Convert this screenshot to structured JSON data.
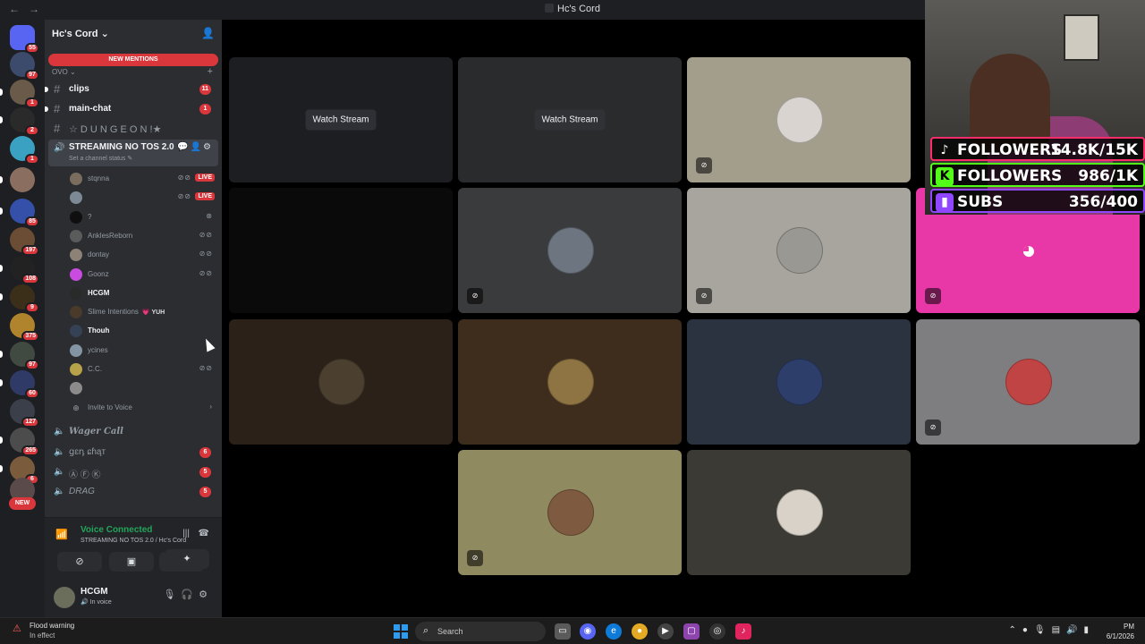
{
  "window": {
    "title": "Hc's Cord"
  },
  "guild": {
    "name": "Hc's Cord",
    "new_mentions": "NEW MENTIONS",
    "category": "OVO",
    "text_channels": [
      {
        "name": "clips",
        "count": "11"
      },
      {
        "name": "main-chat",
        "count": "1"
      },
      {
        "name": "☆ D U N G E O N !★"
      }
    ],
    "active_channel": {
      "name": "STREAMING NO TOS 2.0",
      "status": "Set a channel status"
    },
    "voice_users": [
      {
        "name": "stqnna",
        "live": "LIVE",
        "color": "#7a6d5e"
      },
      {
        "name": "",
        "live": "LIVE",
        "color": "#7d8a95"
      },
      {
        "name": "?",
        "color": "#0f0f0f"
      },
      {
        "name": "AnklesReborn",
        "color": "#5b5b5b"
      },
      {
        "name": "dontay",
        "color": "#8c8275"
      },
      {
        "name": "Goonz",
        "color": "#c94be0"
      },
      {
        "name": "HCGM",
        "color": "#2a2a2a"
      },
      {
        "name": "Slime Intentions",
        "tag": "💗 YUH",
        "color": "#4a3a2c"
      },
      {
        "name": "Thouh",
        "color": "#354155"
      },
      {
        "name": "ycines",
        "color": "#8594a3"
      },
      {
        "name": "C.C.",
        "color": "#b7a24a"
      },
      {
        "name": "",
        "color": "#8b8b8b"
      }
    ],
    "invite": "Invite to Voice",
    "more_channels": [
      {
        "name": "Wager Call"
      },
      {
        "name": "ցɛդ ɕɦąт",
        "count": "6"
      },
      {
        "name": "Ⓐ Ⓕ Ⓚ",
        "count": "5"
      },
      {
        "name": "DRAG",
        "count": "5"
      }
    ]
  },
  "servers": [
    {
      "badge": "55",
      "color": "#5865f2"
    },
    {
      "badge": "97",
      "color": "#3c4a6b"
    },
    {
      "badge": "1",
      "color": "#6a5a4a"
    },
    {
      "badge": "2",
      "color": "#2a2a2a"
    },
    {
      "badge": "1",
      "color": "#3ba1c2"
    },
    {
      "badge": "",
      "color": "#8a6f60"
    },
    {
      "badge": "85",
      "color": "#3450a8"
    },
    {
      "badge": "197",
      "color": "#6b4c34"
    },
    {
      "badge": "108",
      "color": "#222222"
    },
    {
      "badge": "9",
      "color": "#3b2f1a"
    },
    {
      "badge": "375",
      "color": "#b0842c"
    },
    {
      "badge": "97",
      "color": "#404a40"
    },
    {
      "badge": "60",
      "color": "#2f3b66"
    },
    {
      "badge": "127",
      "color": "#3a3f4a"
    },
    {
      "badge": "265",
      "color": "#4c4c4c"
    },
    {
      "badge": "6",
      "color": "#7a5c3c"
    },
    {
      "badge": "",
      "color": "#5a4a4a"
    }
  ],
  "new_label": "NEW",
  "voice_panel": {
    "status": "Voice Connected",
    "location": "STREAMING NO TOS 2.0 / Hc's Cord"
  },
  "user": {
    "name": "HCGM",
    "status": "In voice"
  },
  "stage": {
    "watch_stream": "Watch Stream",
    "tiles": [
      {
        "bg": "#1c1e22",
        "stream": true
      },
      {
        "bg": "#2a2b2d",
        "stream": true
      },
      {
        "bg": "#a39e8c",
        "avatar": "#d9d4cf",
        "mute": true
      },
      {
        "bg": "#0a0a0a"
      },
      {
        "bg": "#3a3b3c",
        "avatar": "#6d7580",
        "mute": true
      },
      {
        "bg": "#a8a59e",
        "avatar": "#9a9893",
        "mute": true
      },
      {
        "bg": "#e838a8",
        "discord": true,
        "mute": true
      },
      {
        "bg": "#2b2118",
        "avatar": "#4b3f30"
      },
      {
        "bg": "#3e2c1d",
        "avatar": "#8e7343"
      },
      {
        "bg": "#2b3240",
        "avatar": "#2d3e6a"
      },
      {
        "bg": "#7e7d80",
        "avatar": "#c04444",
        "mute": true
      },
      {
        "bg": "#8f8a60",
        "avatar": "#7e5a40",
        "mute": true
      },
      {
        "bg": "#3b3a35",
        "avatar": "#d8d2c8"
      }
    ]
  },
  "overlay": {
    "tiktok": {
      "label": "FOLLOWERS",
      "value": "14.8K/15K",
      "color": "#ff2d6a"
    },
    "kick": {
      "label": "FOLLOWERS",
      "value": "986/1K",
      "color": "#53fc18"
    },
    "twitch": {
      "label": "SUBS",
      "value": "356/400",
      "color": "#9146ff"
    }
  },
  "taskbar": {
    "weather_title": "Flood warning",
    "weather_sub": "In effect",
    "search": "Search",
    "time": "PM",
    "date": "6/1/2026"
  }
}
